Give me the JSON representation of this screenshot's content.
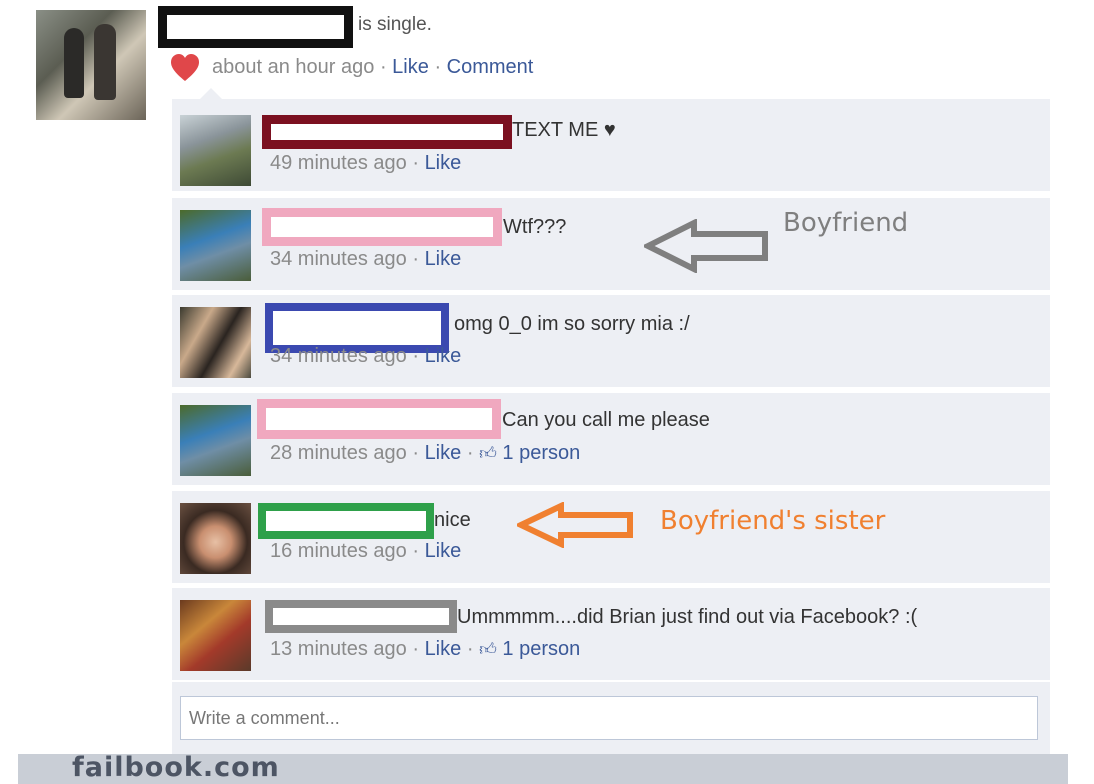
{
  "post": {
    "status_text": "is single.",
    "time": "about an hour ago",
    "like": "Like",
    "comment": "Comment",
    "sep": "·"
  },
  "comments": [
    {
      "text": "TEXT ME ♥",
      "time": "49 minutes ago",
      "like": "Like",
      "redact_color": "#7b1020"
    },
    {
      "text": "Wtf???",
      "time": "34 minutes ago",
      "like": "Like",
      "redact_color": "#f0a8bf"
    },
    {
      "text": "omg 0_0 im so sorry mia :/",
      "time": "34 minutes ago",
      "like": "Like",
      "redact_color": "#3b49b0"
    },
    {
      "text": "Can you call me please",
      "time": "28 minutes ago",
      "like": "Like",
      "likes": "1 person",
      "redact_color": "#f0a8bf"
    },
    {
      "text": "nice",
      "time": "16 minutes ago",
      "like": "Like",
      "redact_color": "#2ea04a"
    },
    {
      "text": "Ummmmm....did Brian just find out via Facebook? :(",
      "time": "13 minutes ago",
      "like": "Like",
      "likes": "1 person",
      "redact_color": "#8a8a8a"
    }
  ],
  "write_placeholder": "Write a comment...",
  "annotations": {
    "boyfriend": "Boyfriend",
    "boyfriend_color": "#7f7f7f",
    "sister": "Boyfriend's sister",
    "sister_color": "#f08030"
  },
  "footer": "failbook.com"
}
